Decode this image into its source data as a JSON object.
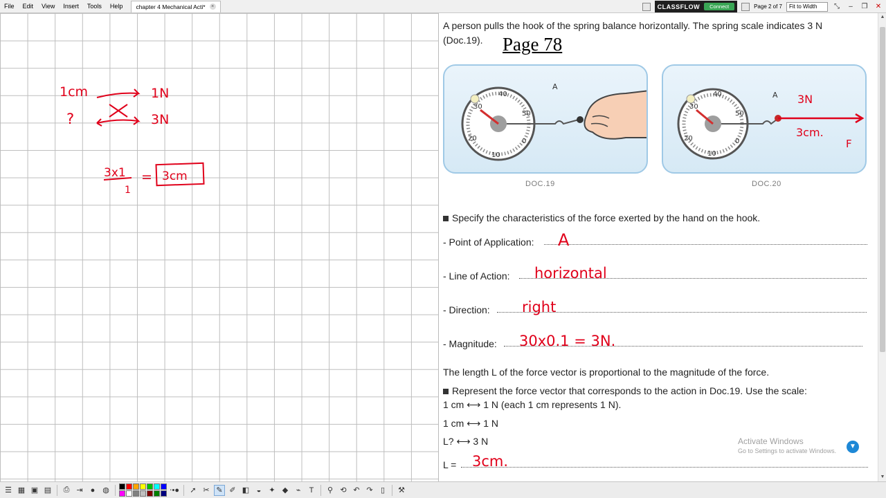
{
  "menu": {
    "items": [
      "File",
      "Edit",
      "View",
      "Insert",
      "Tools",
      "Help"
    ],
    "doc_tab": "chapter 4 Mechanical Acti*"
  },
  "header_right": {
    "classflow": "CLASSFLOW",
    "connect": "Connect",
    "page_indicator": "Page 2 of 7",
    "zoom": "Fit to Width"
  },
  "whiteboard": {
    "line1_left": "1cm",
    "line1_right": "1N",
    "line2_left": "?",
    "line2_right": "3N",
    "calc_num": "3x1",
    "calc_den": "1",
    "calc_eq": "=",
    "calc_result": "3cm"
  },
  "document": {
    "intro_line1": "A person pulls the hook of the spring balance horizontally. The spring scale indicates 3 N",
    "intro_line2": "(Doc.19).",
    "page_number": "Page 78",
    "fig1_caption": "DOC.19",
    "fig2_caption": "DOC.20",
    "fig_point_label": "A",
    "fig2_force_label": "3N",
    "fig2_length_label": "3cm.",
    "fig2_vector_label": "F",
    "specify": "Specify the characteristics of the force exerted by the hand on the hook.",
    "poa_label": "- Point of Application:",
    "poa_answer": "A",
    "loa_label": "- Line of Action:",
    "loa_answer": "horizontal",
    "dir_label": "- Direction:",
    "dir_answer": "right",
    "mag_label": "- Magnitude:",
    "mag_answer": "30x0.1 = 3N.",
    "length_text": "The length L of the force vector is proportional to the magnitude of the force.",
    "represent_line1": "Represent the force vector that corresponds to the action in Doc.19. Use the scale:",
    "represent_line2": "1 cm ⟷ 1 N (each 1 cm represents 1 N).",
    "scale1": "1 cm ⟷ 1 N",
    "scale2": "L? ⟷ 3 N",
    "l_label": "L =",
    "l_answer": "3cm."
  },
  "watermark": {
    "title": "Activate Windows",
    "subtitle": "Go to Settings to activate Windows."
  },
  "colors": {
    "ink": "#e0001a",
    "grid": "#bdbdbd",
    "figure_border": "#9fc9e6",
    "classflow_green": "#3aa655"
  },
  "palette": [
    "#000000",
    "#ff0000",
    "#ffa500",
    "#ffff00",
    "#00c000",
    "#00ffff",
    "#0000ff",
    "#ff00ff",
    "#ffffff",
    "#808080",
    "#c0c0c0",
    "#800000",
    "#008000",
    "#000080"
  ]
}
